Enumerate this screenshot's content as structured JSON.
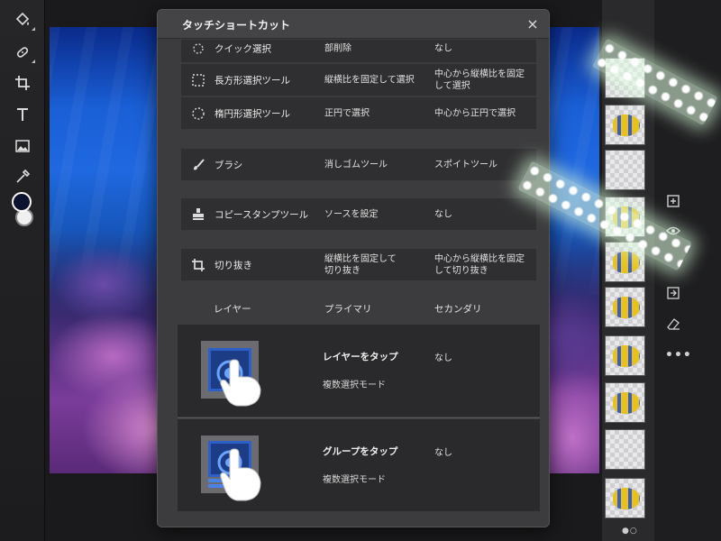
{
  "dialog": {
    "title": "タッチショートカット",
    "close_label": "×"
  },
  "shortcut_rows": [
    {
      "name": "クイック選択",
      "primary": "部削除",
      "secondary": "なし",
      "icon": "quick-select-icon"
    },
    {
      "name": "長方形選択ツール",
      "primary": "縦横比を固定して選択",
      "secondary": "中心から縦横比を固定\nして選択",
      "icon": "rect-marquee-icon"
    },
    {
      "name": "楕円形選択ツール",
      "primary": "正円で選択",
      "secondary": "中心から正円で選択",
      "icon": "ellipse-marquee-icon"
    },
    {
      "name": "ブラシ",
      "primary": "消しゴムツール",
      "secondary": "スポイトツール",
      "icon": "brush-icon"
    },
    {
      "name": "コピースタンプツール",
      "primary": "ソースを設定",
      "secondary": "なし",
      "icon": "clone-stamp-icon"
    },
    {
      "name": "切り抜き",
      "primary": "縦横比を固定して\n切り抜き",
      "secondary": "中心から縦横比を固定\nして切り抜き",
      "icon": "crop-icon"
    }
  ],
  "layer_section": {
    "headers": {
      "layer": "レイヤー",
      "primary": "プライマリ",
      "secondary": "セカンダリ"
    },
    "items": [
      {
        "action": "レイヤーをタップ",
        "secondary": "なし",
        "mode": "複数選択モード",
        "illustration": "tap-layer-illustration"
      },
      {
        "action": "グループをタップ",
        "secondary": "なし",
        "mode": "複数選択モード",
        "illustration": "tap-group-illustration"
      }
    ]
  },
  "layers_panel": {
    "pager": "●○",
    "thumbnails": [
      "transparent",
      "fish",
      "transparent",
      "fish",
      "fish",
      "fish",
      "fish",
      "fish",
      "transparent",
      "fish"
    ]
  },
  "toolbar": {
    "tools": [
      "paint-bucket-icon",
      "healing-brush-icon",
      "crop-icon",
      "type-icon",
      "image-icon",
      "eyedropper-icon"
    ],
    "foreground_color": "#0a1430",
    "background_color": "#f0f0f0"
  },
  "right_tools": [
    "add-layer-icon",
    "visibility-icon",
    "import-icon",
    "eraser-icon",
    "more-icon"
  ],
  "colors": {
    "dialog_bg": "#3c3c3e",
    "row_bg": "#2f2f31",
    "accent": "#3e82f7"
  }
}
